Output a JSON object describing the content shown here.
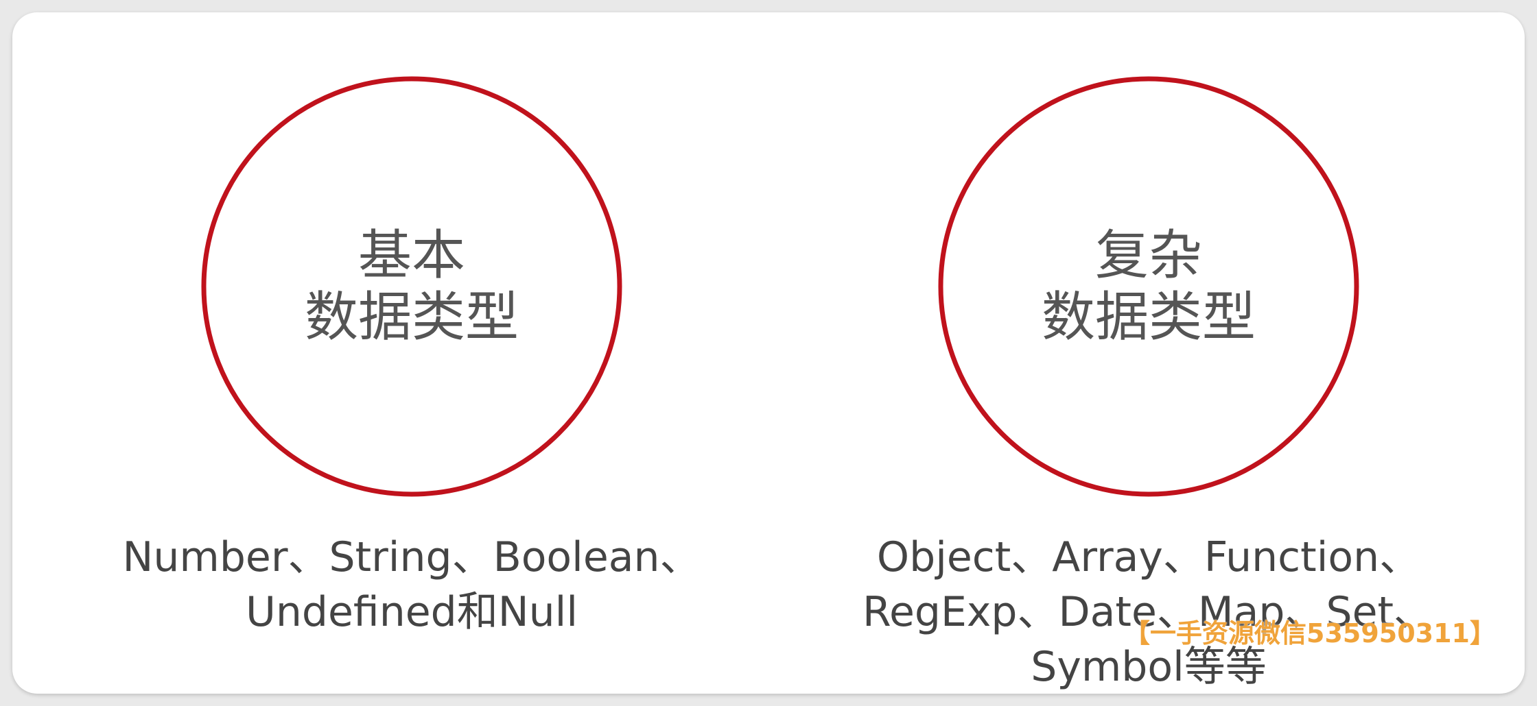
{
  "colors": {
    "circle_stroke": "#c0121c",
    "label_text": "#555555",
    "list_text": "#444444",
    "watermark": "#f0a33a"
  },
  "primitive": {
    "title_line1": "基本",
    "title_line2": "数据类型",
    "list_line1": "Number、String、Boolean、",
    "list_line2": "Undefined和Null"
  },
  "complex": {
    "title_line1": "复杂",
    "title_line2": "数据类型",
    "list_line1": "Object、Array、Function、",
    "list_line2": "RegExp、Date、Map、Set、",
    "list_line3": "Symbol等等"
  },
  "watermark": {
    "text": "【一手资源微信535950311】"
  }
}
